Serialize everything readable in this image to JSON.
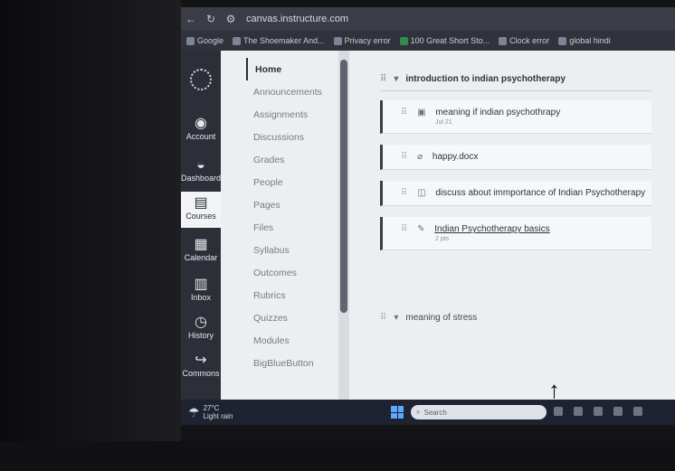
{
  "browser": {
    "url": "canvas.instructure.com",
    "bookmarks": [
      "Google",
      "The Shoemaker And...",
      "Privacy error",
      "100 Great Short Sto...",
      "Clock error",
      "global hindi"
    ]
  },
  "global_nav": {
    "items": [
      {
        "label": "Account",
        "icon": "account-icon"
      },
      {
        "label": "Dashboard",
        "icon": "dashboard-icon"
      },
      {
        "label": "Courses",
        "icon": "courses-icon",
        "active": true
      },
      {
        "label": "Calendar",
        "icon": "calendar-icon"
      },
      {
        "label": "Inbox",
        "icon": "inbox-icon"
      },
      {
        "label": "History",
        "icon": "history-icon"
      },
      {
        "label": "Commons",
        "icon": "commons-icon"
      }
    ]
  },
  "course_nav": {
    "items": [
      "Home",
      "Announcements",
      "Assignments",
      "Discussions",
      "Grades",
      "People",
      "Pages",
      "Files",
      "Syllabus",
      "Outcomes",
      "Rubrics",
      "Quizzes",
      "Modules",
      "BigBlueButton"
    ]
  },
  "modules": [
    {
      "title": "introduction to indian psychotherapy",
      "items": [
        {
          "type": "assignment",
          "title": "meaning if indian psychothrapy",
          "sub": "Jul 21"
        },
        {
          "type": "attachment",
          "title": "happy.docx",
          "sub": ""
        },
        {
          "type": "discussion",
          "title": "discuss about immportance of Indian Psychotherapy",
          "sub": ""
        },
        {
          "type": "quiz",
          "title": "Indian Psychotherapy basics",
          "sub": "2 pts",
          "link": true
        }
      ]
    },
    {
      "title": "meaning of stress",
      "items": []
    }
  ],
  "taskbar": {
    "temperature": "27°C",
    "weather": "Light rain",
    "search_placeholder": "Search"
  },
  "colors": {
    "nav_bg": "#2c2f38",
    "page_bg": "#eceef1",
    "windows_accent": "#5aa8ff"
  }
}
